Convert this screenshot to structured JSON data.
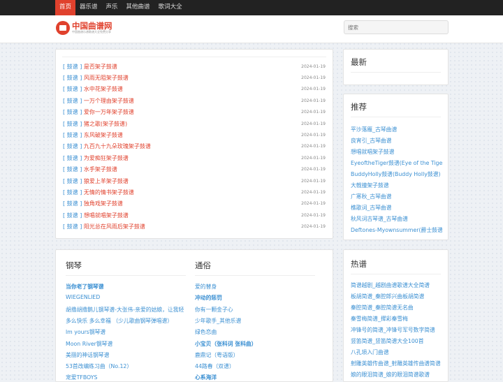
{
  "topnav": [
    "首页",
    "器乐谱",
    "声乐",
    "其他曲谱",
    "歌词大全"
  ],
  "logo": {
    "title": "中国曲谱网",
    "subtitle": "中国曲谱乐谱歌谱大全免费分享"
  },
  "search": {
    "placeholder": "搜索"
  },
  "list": [
    {
      "cat": "[ 鼓谱 ]",
      "title": "是否架子鼓谱",
      "date": "2024-01-19"
    },
    {
      "cat": "[ 鼓谱 ]",
      "title": "风雨无阻架子鼓谱",
      "date": "2024-01-19"
    },
    {
      "cat": "[ 鼓谱 ]",
      "title": "水中花架子鼓谱",
      "date": "2024-01-19"
    },
    {
      "cat": "[ 鼓谱 ]",
      "title": "一万个理由架子鼓谱",
      "date": "2024-01-19"
    },
    {
      "cat": "[ 鼓谱 ]",
      "title": "爱你一万年架子鼓谱",
      "date": "2024-01-19"
    },
    {
      "cat": "[ 鼓谱 ]",
      "title": "猪之歌(架子鼓谱)",
      "date": "2024-01-19"
    },
    {
      "cat": "[ 鼓谱 ]",
      "title": "东风破架子鼓谱",
      "date": "2024-01-19"
    },
    {
      "cat": "[ 鼓谱 ]",
      "title": "九百九十九朵玫瑰架子鼓谱",
      "date": "2024-01-19"
    },
    {
      "cat": "[ 鼓谱 ]",
      "title": "为爱痴狂架子鼓谱",
      "date": "2024-01-19"
    },
    {
      "cat": "[ 鼓谱 ]",
      "title": "水手架子鼓谱",
      "date": "2024-01-19"
    },
    {
      "cat": "[ 鼓谱 ]",
      "title": "狼爱上羊架子鼓谱",
      "date": "2024-01-19"
    },
    {
      "cat": "[ 鼓谱 ]",
      "title": "无情的情书架子鼓谱",
      "date": "2024-01-19"
    },
    {
      "cat": "[ 鼓谱 ]",
      "title": "独角戏架子鼓谱",
      "date": "2024-01-19"
    },
    {
      "cat": "[ 鼓谱 ]",
      "title": "想唱就唱架子鼓谱",
      "date": "2024-01-19"
    },
    {
      "cat": "[ 鼓谱 ]",
      "title": "阳光总在风雨后架子鼓谱",
      "date": "2024-01-19"
    }
  ],
  "piano": {
    "title": "钢琴",
    "items": [
      {
        "text": "当你老了钢琴谱",
        "bold": true
      },
      {
        "text": "WIEGENLIED",
        "bold": false
      },
      {
        "text": "胡撸胡撸鹅儿钢琴谱-大张伟-亲爱的姑娘，让我轻",
        "bold": false
      },
      {
        "text": "多么快乐 多么幸福 （少儿歌曲钢琴弹唱谱）",
        "bold": false
      },
      {
        "text": "lm yours钢琴谱",
        "bold": false
      },
      {
        "text": "Moon River钢琴谱",
        "bold": false
      },
      {
        "text": "美丽的神话钢琴谱",
        "bold": false
      },
      {
        "text": "53首改编练习曲（No.12）",
        "bold": false
      },
      {
        "text": "宠爱TFBOYS",
        "bold": false
      }
    ]
  },
  "popular": {
    "title": "通俗",
    "items": [
      {
        "text": "爱的替身",
        "bold": false
      },
      {
        "text": "冲动的惩罚",
        "bold": true
      },
      {
        "text": "你有一颗金子心",
        "bold": false
      },
      {
        "text": "少年歌手_其他乐谱",
        "bold": false
      },
      {
        "text": "绿色恋曲",
        "bold": false
      },
      {
        "text": "小宝贝（张科词 张科曲）",
        "bold": true
      },
      {
        "text": "鹿鼎记（粤语版）",
        "bold": false
      },
      {
        "text": "44路春（双谱）",
        "bold": false
      },
      {
        "text": "心系海洋",
        "bold": true
      }
    ]
  },
  "latest": {
    "title": "最新"
  },
  "recommend": {
    "title": "推荐",
    "items": [
      "平沙落雁_古琴曲谱",
      "良宵引_古琴曲谱",
      "想唱就唱架子鼓谱",
      "EyeoftheTiger鼓谱(Eye of the Tiger",
      "BuddyHolly鼓谱(Buddy Holly鼓谱)",
      "大戟撞架子鼓谱",
      "广寒秋_古琴曲谱",
      "樵歌词_古琴曲谱",
      "秋风词古琴谱_古琴曲谱",
      "Deftones-Myownsummer(爵士鼓谱)"
    ]
  },
  "hot": {
    "title": "热谱",
    "items": [
      "简谱越剧_越剧曲谱歌谱大全简谱",
      "板胡简谱_秦腔郎兴曲板胡简谱",
      "秦腔简谱_秦腔简谱无名曲",
      "秦雪梅简谱_撵彩秦雪梅",
      "冲锋号的简谱_冲锋号军号数字简谱",
      "竖笛简谱_竖笛简谱大全100首",
      "八孔埙入门曲谱",
      "射雕英雄传曲谱_射雕英雄传曲谱简谱",
      "娘的眼泪简谱_娘的眼泪简谱歌谱"
    ]
  },
  "colors": {
    "accent": "#e0412d",
    "link": "#3a8fd2",
    "topbar": "#222222"
  }
}
